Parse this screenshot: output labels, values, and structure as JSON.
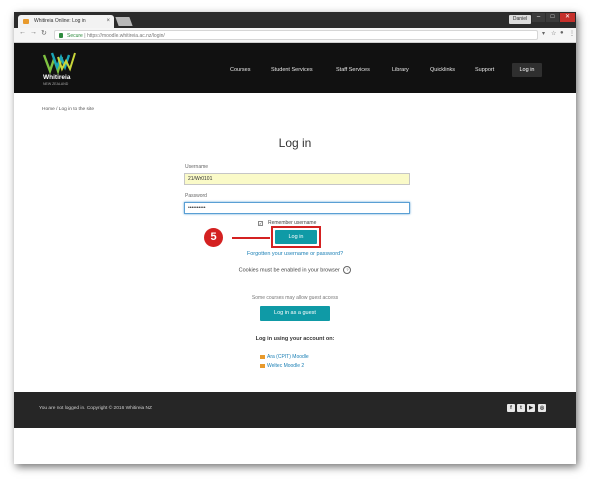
{
  "browser": {
    "tab_title": "Whitireia Online: Log in",
    "tab_close": "×",
    "profile_name": "Daniel",
    "address_secure_label": "Secure",
    "address_url": "https://moodle.whitireia.ac.nz/login/"
  },
  "site": {
    "logo_text": "Whitireia",
    "logo_sub": "NEW ZEALAND",
    "nav": [
      "Courses",
      "Student Services",
      "Staff Services",
      "Library",
      "Quicklinks",
      "Support"
    ],
    "nav_login": "Log in"
  },
  "breadcrumb": "Home / Log in to the site",
  "login": {
    "title": "Log in",
    "username_label": "Username",
    "username_value": "21/Wr0101",
    "password_label": "Password",
    "password_value": "••••••••••",
    "remember_label": "Remember username",
    "login_button": "Log in",
    "forgot_link": "Forgotten your username or password?",
    "cookies_text": "Cookies must be enabled in your browser",
    "guest_note": "Some courses may allow guest access",
    "guest_button": "Log in as a guest",
    "using_account_heading": "Log in using your account on:",
    "providers": [
      "Ara (CPIT) Moodle",
      "Weltec Moodle 2"
    ]
  },
  "annotation": {
    "step_number": "5"
  },
  "footer": {
    "text": "You are not logged in.   Copyright © 2016 Whitireia NZ"
  },
  "colors": {
    "accent": "#0f9aa6",
    "annotation_red": "#d42121",
    "header_bg": "#111111",
    "footer_bg": "#262626"
  }
}
